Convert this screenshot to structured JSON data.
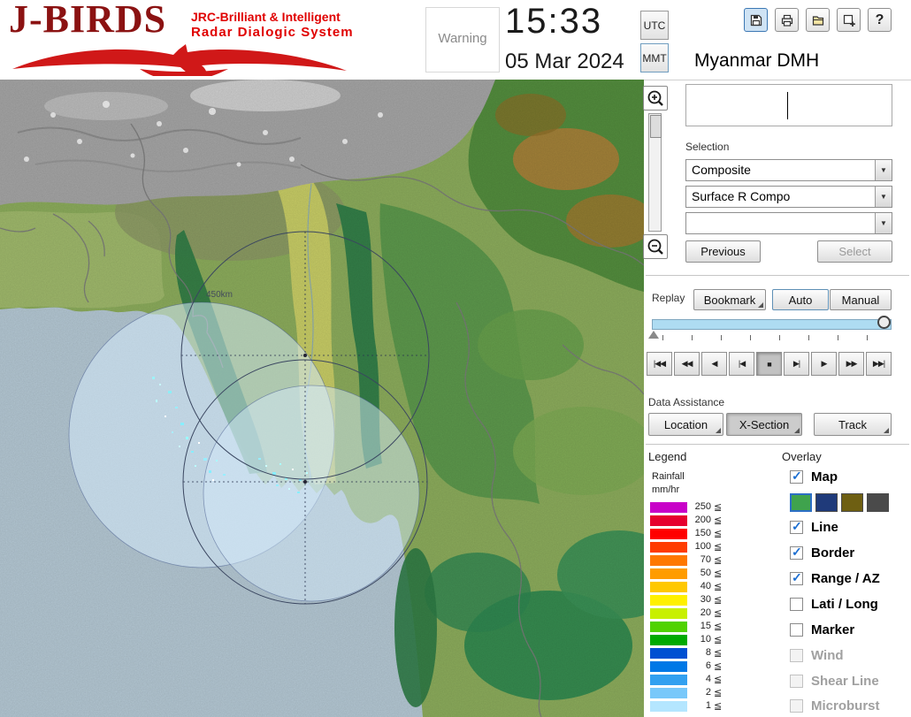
{
  "ui": {
    "dropdown_arrow": "▼",
    "accent_blue": "#a6cce9"
  },
  "header": {
    "logo_title": "J-BIRDS",
    "logo_tagline1": "JRC-Brilliant & Intelligent",
    "logo_tagline2": "Radar  Dialogic  System",
    "warning_label": "Warning",
    "time": "15:33",
    "date": "05 Mar 2024",
    "tz_utc": "UTC",
    "tz_mmt": "MMT",
    "tz_selected": "MMT",
    "org_name": "Myanmar DMH",
    "help_glyph": "?"
  },
  "selection": {
    "label": "Selection",
    "dropdown1_value": "Composite",
    "dropdown2_value": "Surface R Compo",
    "dropdown3_value": "",
    "previous_label": "Previous",
    "select_label": "Select"
  },
  "replay": {
    "label": "Replay",
    "bookmark_label": "Bookmark",
    "auto_label": "Auto",
    "manual_label": "Manual",
    "mode_selected": "Auto",
    "playback_glyphs": [
      "|◀◀",
      "◀◀",
      "◀",
      "|◀",
      "■",
      "▶|",
      "▶",
      "▶▶",
      "▶▶|"
    ]
  },
  "data_assistance": {
    "label": "Data Assistance",
    "location_label": "Location",
    "xsection_label": "X-Section",
    "track_label": "Track"
  },
  "legend": {
    "label": "Legend",
    "unit1": "Rainfall",
    "unit2": "mm/hr",
    "lte": "≦",
    "scale": [
      {
        "value": "250",
        "color": "#c800c8"
      },
      {
        "value": "200",
        "color": "#e6002e"
      },
      {
        "value": "150",
        "color": "#ff0000"
      },
      {
        "value": "100",
        "color": "#ff3c00"
      },
      {
        "value": "70",
        "color": "#ff7800"
      },
      {
        "value": "50",
        "color": "#ff9c00"
      },
      {
        "value": "40",
        "color": "#ffc800"
      },
      {
        "value": "30",
        "color": "#fff000"
      },
      {
        "value": "20",
        "color": "#c8f000"
      },
      {
        "value": "15",
        "color": "#50d200"
      },
      {
        "value": "10",
        "color": "#00aa00"
      },
      {
        "value": "8",
        "color": "#0050d2"
      },
      {
        "value": "6",
        "color": "#0078e6"
      },
      {
        "value": "4",
        "color": "#32a0f0"
      },
      {
        "value": "2",
        "color": "#78c8fa"
      },
      {
        "value": "1",
        "color": "#b4e6ff"
      }
    ]
  },
  "overlay": {
    "label": "Overlay",
    "items": [
      {
        "label": "Map",
        "checked": true,
        "enabled": true
      },
      {
        "label": "Line",
        "checked": true,
        "enabled": true
      },
      {
        "label": "Border",
        "checked": true,
        "enabled": true
      },
      {
        "label": "Range / AZ",
        "checked": true,
        "enabled": true
      },
      {
        "label": "Lati / Long",
        "checked": false,
        "enabled": true
      },
      {
        "label": "Marker",
        "checked": false,
        "enabled": true
      },
      {
        "label": "Wind",
        "checked": false,
        "enabled": false
      },
      {
        "label": "Shear Line",
        "checked": false,
        "enabled": false
      },
      {
        "label": "Microburst",
        "checked": false,
        "enabled": false
      }
    ],
    "map_colors": [
      "#3fa34d",
      "#1f3a7a",
      "#6e5f12",
      "#4a4a4a"
    ]
  },
  "map": {
    "range_label": "450km"
  }
}
